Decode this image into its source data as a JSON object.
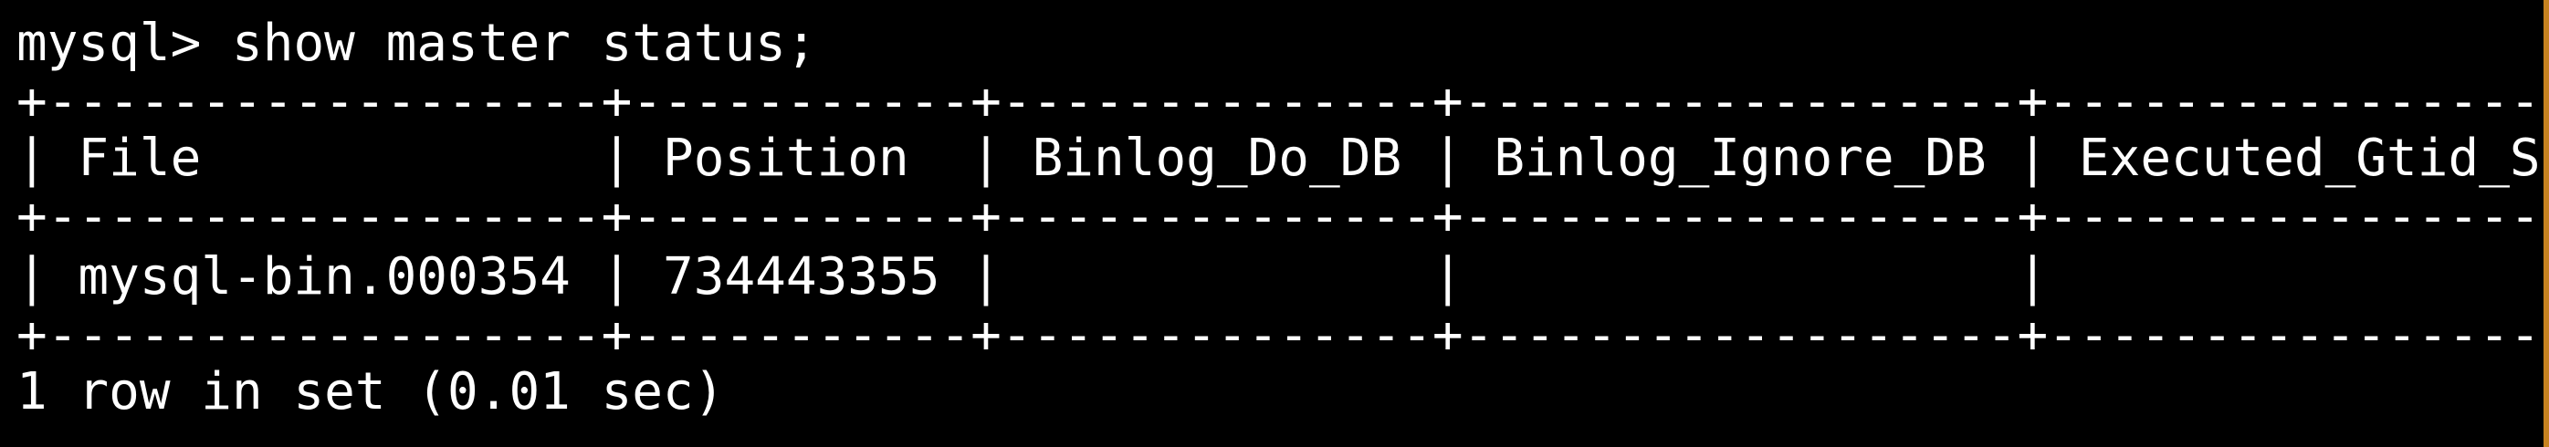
{
  "terminal": {
    "prompt": "mysql>",
    "command": "show master status;",
    "separator": "+------------------+-----------+--------------+------------------+-------------------+",
    "header_row": "| File             | Position  | Binlog_Do_DB | Binlog_Ignore_DB | Executed_Gtid_Set |",
    "data_row": "| mysql-bin.000354 | 734443355 |              |                  |                   |",
    "result_summary": "1 row in set (0.01 sec)"
  },
  "table": {
    "columns": [
      "File",
      "Position",
      "Binlog_Do_DB",
      "Binlog_Ignore_DB",
      "Executed_Gtid_Set"
    ],
    "rows": [
      [
        "mysql-bin.000354",
        "734443355",
        "",
        "",
        ""
      ]
    ]
  },
  "colors": {
    "background": "#000000",
    "text": "#ffffff",
    "window_edge": "#c7821f"
  }
}
